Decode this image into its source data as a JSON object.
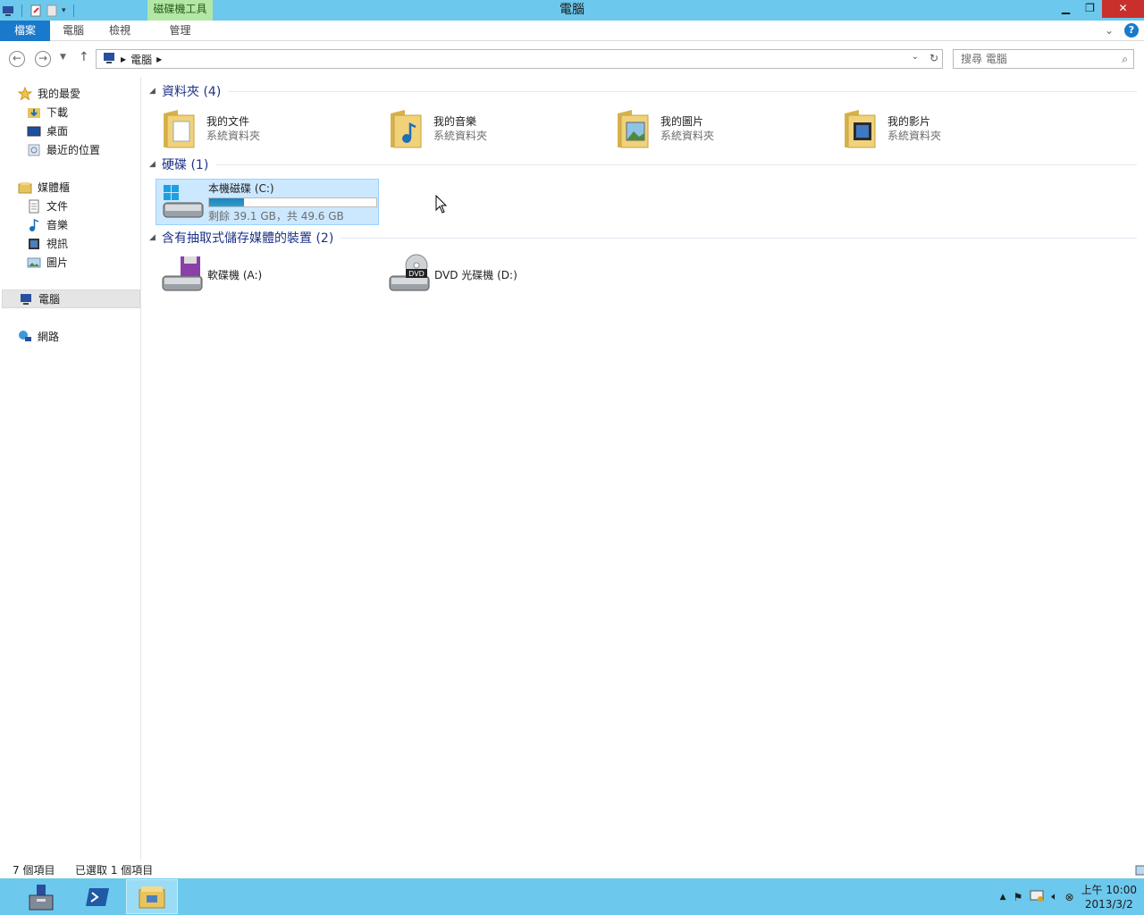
{
  "window": {
    "title": "電腦",
    "context_tab": "磁碟機工具"
  },
  "ribbon": {
    "tabs": [
      "檔案",
      "電腦",
      "檢視",
      "管理"
    ]
  },
  "address": {
    "crumbs": [
      "電腦"
    ],
    "search_placeholder": "搜尋 電腦"
  },
  "sidebar": {
    "favorites": {
      "label": "我的最愛",
      "items": [
        "下載",
        "桌面",
        "最近的位置"
      ]
    },
    "libraries": {
      "label": "媒體櫃",
      "items": [
        "文件",
        "音樂",
        "視訊",
        "圖片"
      ]
    },
    "computer": "電腦",
    "network": "網路"
  },
  "groups": {
    "folders": {
      "title": "資料夾 (4)",
      "items": [
        {
          "name": "我的文件",
          "sub": "系統資料夾"
        },
        {
          "name": "我的音樂",
          "sub": "系統資料夾"
        },
        {
          "name": "我的圖片",
          "sub": "系統資料夾"
        },
        {
          "name": "我的影片",
          "sub": "系統資料夾"
        }
      ]
    },
    "drives": {
      "title": "硬碟 (1)",
      "items": [
        {
          "name": "本機磁碟 (C:)",
          "sub": "剩餘 39.1 GB，共 49.6 GB",
          "used_fraction": 0.21
        }
      ]
    },
    "removable": {
      "title": "含有抽取式儲存媒體的裝置 (2)",
      "items": [
        {
          "name": "軟碟機 (A:)"
        },
        {
          "name": "DVD 光碟機 (D:)"
        }
      ]
    }
  },
  "status": {
    "count": "7 個項目",
    "selected": "已選取 1 個項目"
  },
  "taskbar": {
    "time": "上午 10:00",
    "date": "2013/3/2"
  },
  "colors": {
    "titlebar": "#6cc8ec",
    "file_tab": "#1979ca",
    "context_tab": "#b4e6a6",
    "selection": "#cce8ff"
  }
}
